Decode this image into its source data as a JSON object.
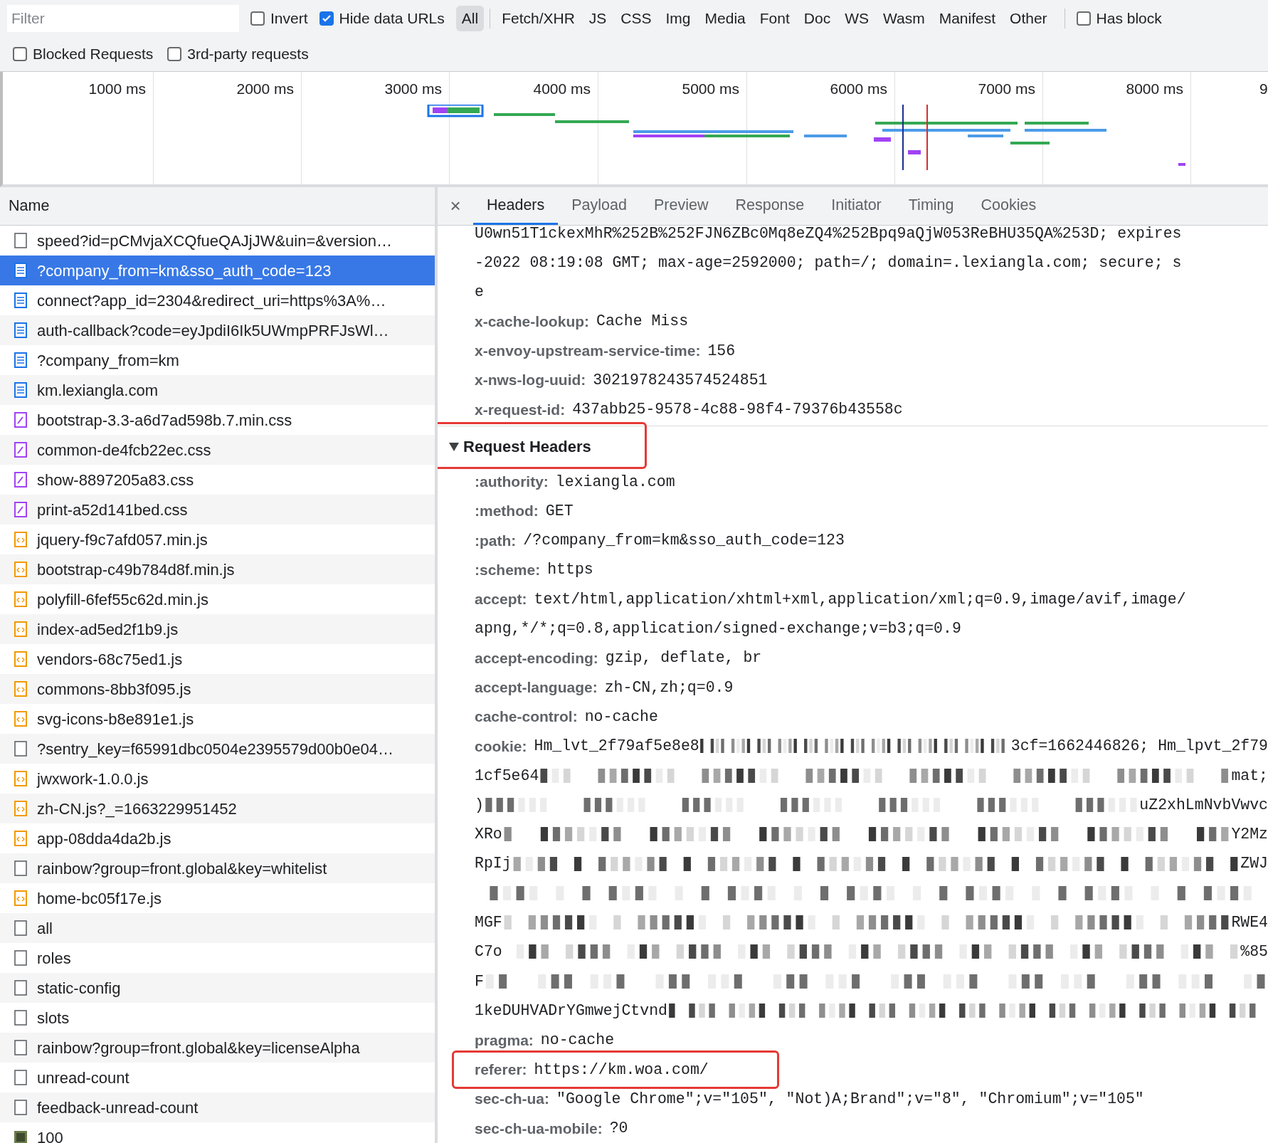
{
  "filter_bar": {
    "placeholder": "Filter",
    "checks_row1": [
      {
        "label": "Invert",
        "checked": false
      },
      {
        "label": "Hide data URLs",
        "checked": true
      }
    ],
    "types": [
      {
        "label": "All",
        "selected": true
      },
      {
        "label": "Fetch/XHR",
        "selected": false
      },
      {
        "label": "JS",
        "selected": false
      },
      {
        "label": "CSS",
        "selected": false
      },
      {
        "label": "Img",
        "selected": false
      },
      {
        "label": "Media",
        "selected": false
      },
      {
        "label": "Font",
        "selected": false
      },
      {
        "label": "Doc",
        "selected": false
      },
      {
        "label": "WS",
        "selected": false
      },
      {
        "label": "Wasm",
        "selected": false
      },
      {
        "label": "Manifest",
        "selected": false
      },
      {
        "label": "Other",
        "selected": false
      }
    ],
    "checks_end": [
      {
        "label": "Has block",
        "checked": false
      }
    ],
    "checks_row2": [
      {
        "label": "Blocked Requests",
        "checked": false
      },
      {
        "label": "3rd-party requests",
        "checked": false
      }
    ]
  },
  "timeline": {
    "ticks": [
      "1000 ms",
      "2000 ms",
      "3000 ms",
      "4000 ms",
      "5000 ms",
      "6000 ms",
      "7000 ms",
      "8000 ms",
      "9"
    ]
  },
  "requests": {
    "column": "Name",
    "rows": [
      {
        "name": "speed?id=pCMvjaXCQfueQAJjJW&uin=&version…",
        "kind": "other",
        "selected": false
      },
      {
        "name": "?company_from=km&sso_auth_code=123",
        "kind": "doc",
        "selected": true
      },
      {
        "name": "connect?app_id=2304&redirect_uri=https%3A%…",
        "kind": "doc",
        "selected": false
      },
      {
        "name": "auth-callback?code=eyJpdiI6Ik5UWmpPRFJsWl…",
        "kind": "doc",
        "selected": false
      },
      {
        "name": "?company_from=km",
        "kind": "doc",
        "selected": false
      },
      {
        "name": "km.lexiangla.com",
        "kind": "doc",
        "selected": false
      },
      {
        "name": "bootstrap-3.3-a6d7ad598b.7.min.css",
        "kind": "css",
        "selected": false
      },
      {
        "name": "common-de4fcb22ec.css",
        "kind": "css",
        "selected": false
      },
      {
        "name": "show-8897205a83.css",
        "kind": "css",
        "selected": false
      },
      {
        "name": "print-a52d141bed.css",
        "kind": "css",
        "selected": false
      },
      {
        "name": "jquery-f9c7afd057.min.js",
        "kind": "js",
        "selected": false
      },
      {
        "name": "bootstrap-c49b784d8f.min.js",
        "kind": "js",
        "selected": false
      },
      {
        "name": "polyfill-6fef55c62d.min.js",
        "kind": "js",
        "selected": false
      },
      {
        "name": "index-ad5ed2f1b9.js",
        "kind": "js",
        "selected": false
      },
      {
        "name": "vendors-68c75ed1.js",
        "kind": "js",
        "selected": false
      },
      {
        "name": "commons-8bb3f095.js",
        "kind": "js",
        "selected": false
      },
      {
        "name": "svg-icons-b8e891e1.js",
        "kind": "js",
        "selected": false
      },
      {
        "name": "?sentry_key=f65991dbc0504e2395579d00b0e04…",
        "kind": "other",
        "selected": false
      },
      {
        "name": "jwxwork-1.0.0.js",
        "kind": "js",
        "selected": false
      },
      {
        "name": "zh-CN.js?_=1663229951452",
        "kind": "js",
        "selected": false
      },
      {
        "name": "app-08dda4da2b.js",
        "kind": "js",
        "selected": false
      },
      {
        "name": "rainbow?group=front.global&key=whitelist",
        "kind": "other",
        "selected": false
      },
      {
        "name": "home-bc05f17e.js",
        "kind": "js",
        "selected": false
      },
      {
        "name": "all",
        "kind": "other",
        "selected": false
      },
      {
        "name": "roles",
        "kind": "other",
        "selected": false
      },
      {
        "name": "static-config",
        "kind": "other",
        "selected": false
      },
      {
        "name": "slots",
        "kind": "other",
        "selected": false
      },
      {
        "name": "rainbow?group=front.global&key=licenseAlpha",
        "kind": "other",
        "selected": false
      },
      {
        "name": "unread-count",
        "kind": "other",
        "selected": false
      },
      {
        "name": "feedback-unread-count",
        "kind": "other",
        "selected": false
      },
      {
        "name": "100",
        "kind": "image",
        "selected": false
      }
    ]
  },
  "details": {
    "close": "×",
    "tabs": [
      {
        "label": "Headers",
        "selected": true
      },
      {
        "label": "Payload",
        "selected": false
      },
      {
        "label": "Preview",
        "selected": false
      },
      {
        "label": "Response",
        "selected": false
      },
      {
        "label": "Initiator",
        "selected": false
      },
      {
        "label": "Timing",
        "selected": false
      },
      {
        "label": "Cookies",
        "selected": false
      }
    ],
    "response_tail": [
      {
        "kind": "wrap",
        "value": "U0wn51T1ckexMhR%252B%252FJN6ZBc0Mq8eZQ4%252Bpq9aQjW053ReBHU35QA%253D; expires"
      },
      {
        "kind": "wrap",
        "value": "-2022 08:19:08 GMT; max-age=2592000; path=/; domain=.lexiangla.com; secure; s"
      },
      {
        "kind": "wrap",
        "value": "e"
      },
      {
        "kind": "header",
        "name": "x-cache-lookup:",
        "value": "Cache Miss"
      },
      {
        "kind": "header",
        "name": "x-envoy-upstream-service-time:",
        "value": "156"
      },
      {
        "kind": "header",
        "name": "x-nws-log-uuid:",
        "value": "3021978243574524851"
      },
      {
        "kind": "header",
        "name": "x-request-id:",
        "value": "437abb25-9578-4c88-98f4-79376b43558c"
      }
    ],
    "section": {
      "title": "Request Headers",
      "expanded": true,
      "highlighted": true
    },
    "request_headers": [
      {
        "kind": "header",
        "name": ":authority:",
        "value": "lexiangla.com"
      },
      {
        "kind": "header",
        "name": ":method:",
        "value": "GET"
      },
      {
        "kind": "header",
        "name": ":path:",
        "value": "/?company_from=km&sso_auth_code=123"
      },
      {
        "kind": "header",
        "name": ":scheme:",
        "value": "https"
      },
      {
        "kind": "header",
        "name": "accept:",
        "value": "text/html,application/xhtml+xml,application/xml;q=0.9,image/avif,image/"
      },
      {
        "kind": "wrap",
        "value": "apng,*/*;q=0.8,application/signed-exchange;v=b3;q=0.9"
      },
      {
        "kind": "header",
        "name": "accept-encoding:",
        "value": "gzip, deflate, br"
      },
      {
        "kind": "header",
        "name": "accept-language:",
        "value": "zh-CN,zh;q=0.9"
      },
      {
        "kind": "header",
        "name": "cache-control:",
        "value": "no-cache"
      },
      {
        "kind": "masked",
        "name": "cookie:",
        "left": "Hm_lvt_2f79af5e8e8",
        "right": "3cf=1662446826; Hm_lpvt_2f79"
      },
      {
        "kind": "masked",
        "left": "1cf5e64",
        "right": "mat;"
      },
      {
        "kind": "masked",
        "left": ")",
        "right": "uZ2xhLmNvbVwvc"
      },
      {
        "kind": "masked",
        "left": "XRo",
        "right": "Y2Mz"
      },
      {
        "kind": "masked",
        "left": "RpIj",
        "right": "ZWJ"
      },
      {
        "kind": "masked"
      },
      {
        "kind": "masked",
        "left": "MGF",
        "right": "RWE4"
      },
      {
        "kind": "masked",
        "left": "C7o",
        "right": "%85"
      },
      {
        "kind": "masked",
        "left": "F"
      },
      {
        "kind": "masked",
        "left": "1keDUHVADrYGmwejCtvnd"
      },
      {
        "kind": "header",
        "name": "pragma:",
        "value": "no-cache"
      },
      {
        "kind": "marked_header",
        "name": "referer:",
        "value": "https://km.woa.com/"
      },
      {
        "kind": "header",
        "name": "sec-ch-ua:",
        "value": "\"Google Chrome\";v=\"105\", \"Not)A;Brand\";v=\"8\", \"Chromium\";v=\"105\""
      },
      {
        "kind": "header",
        "name": "sec-ch-ua-mobile:",
        "value": "?0"
      }
    ]
  }
}
